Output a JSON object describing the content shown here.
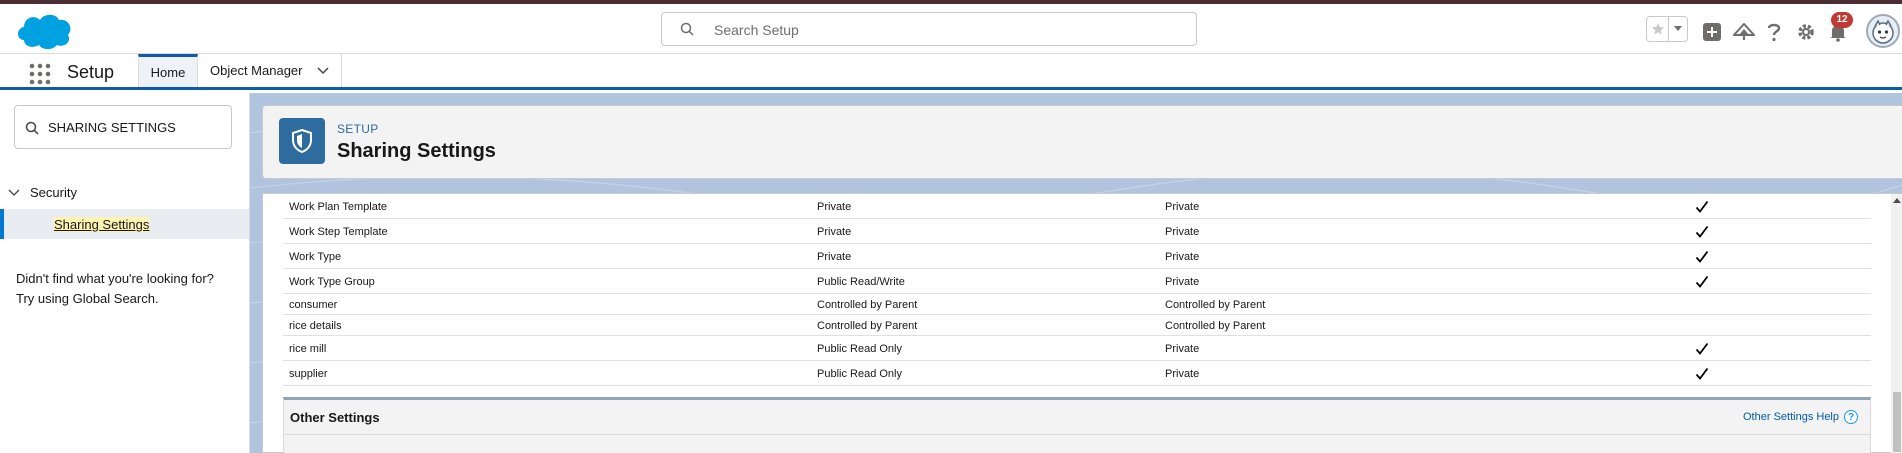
{
  "header": {
    "search_placeholder": "Search Setup",
    "notification_count": "12",
    "brand_color": "#00a1e0"
  },
  "nav": {
    "app_name": "Setup",
    "tabs": [
      {
        "label": "Home"
      },
      {
        "label": "Object Manager"
      }
    ]
  },
  "sidebar": {
    "quickfind_value": "SHARING SETTINGS",
    "tree_parent": "Security",
    "tree_child": "Sharing Settings",
    "help_line1": "Didn't find what you're looking for?",
    "help_line2": "Try using Global Search."
  },
  "page": {
    "eyebrow": "SETUP",
    "title": "Sharing Settings"
  },
  "table": {
    "rows": [
      {
        "object": "Work Plan Template",
        "default_internal": "Private",
        "default_external": "Private",
        "grant_hierarchy": true
      },
      {
        "object": "Work Step Template",
        "default_internal": "Private",
        "default_external": "Private",
        "grant_hierarchy": true
      },
      {
        "object": "Work Type",
        "default_internal": "Private",
        "default_external": "Private",
        "grant_hierarchy": true
      },
      {
        "object": "Work Type Group",
        "default_internal": "Public Read/Write",
        "default_external": "Private",
        "grant_hierarchy": true
      },
      {
        "object": "consumer",
        "default_internal": "Controlled by Parent",
        "default_external": "Controlled by Parent",
        "grant_hierarchy": false
      },
      {
        "object": "rice details",
        "default_internal": "Controlled by Parent",
        "default_external": "Controlled by Parent",
        "grant_hierarchy": false
      },
      {
        "object": "rice mill",
        "default_internal": "Public Read Only",
        "default_external": "Private",
        "grant_hierarchy": true
      },
      {
        "object": "supplier",
        "default_internal": "Public Read Only",
        "default_external": "Private",
        "grant_hierarchy": true
      }
    ]
  },
  "other_settings": {
    "title": "Other Settings",
    "help_link": "Other Settings Help",
    "help_glyph": "?"
  }
}
